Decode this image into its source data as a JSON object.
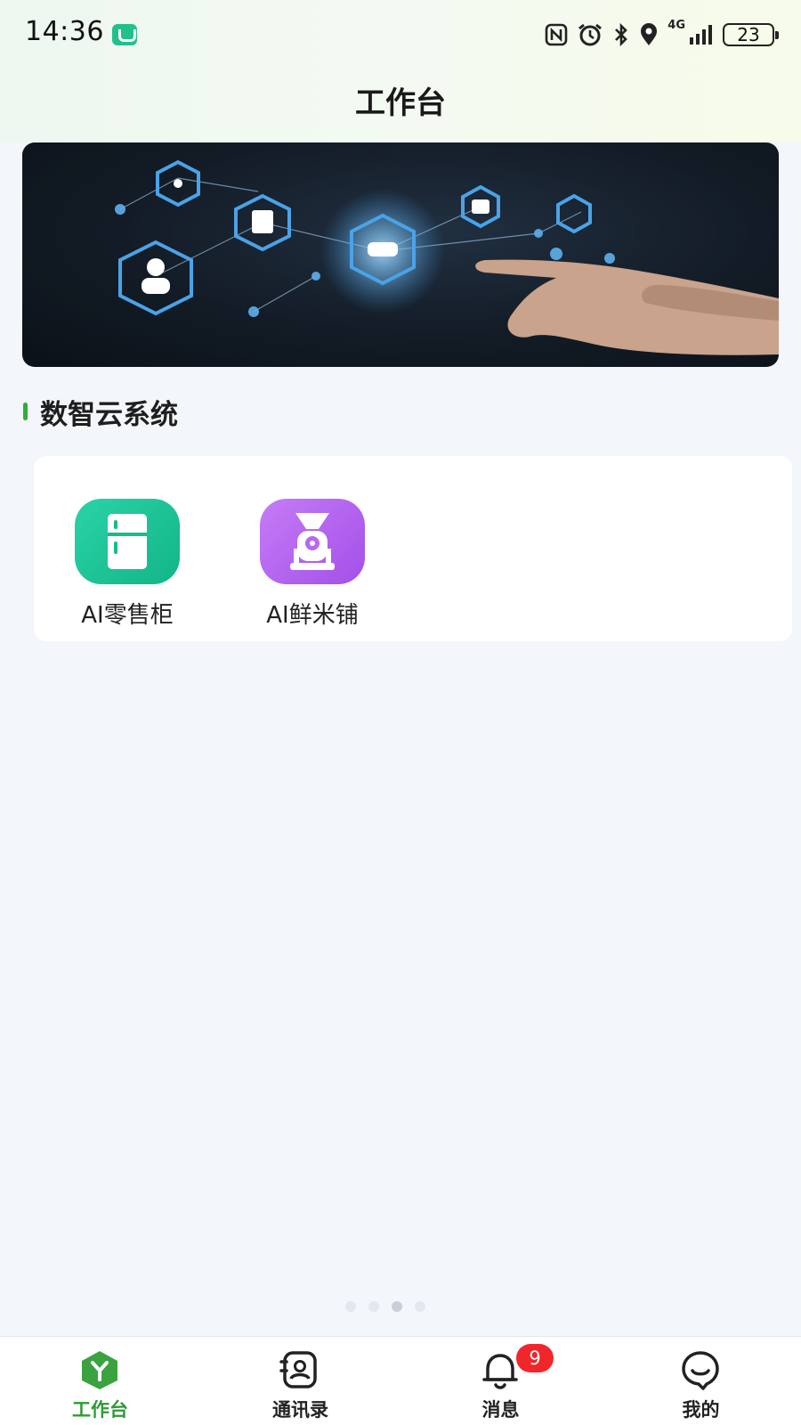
{
  "status_bar": {
    "time": "14:36",
    "network": "4G",
    "battery": "23",
    "icons": [
      "nfc-icon",
      "alarm-icon",
      "bluetooth-icon",
      "location-icon",
      "signal-icon",
      "battery-icon"
    ]
  },
  "header": {
    "title": "工作台"
  },
  "banner": {
    "icon": "tech-network-banner"
  },
  "section": {
    "title": "数智云系统"
  },
  "apps": [
    {
      "label": "AI零售柜",
      "icon": "fridge-icon",
      "color": "#1fc79a"
    },
    {
      "label": "AI鲜米铺",
      "icon": "rice-machine-icon",
      "color": "#b564f0"
    }
  ],
  "pager": {
    "count": 4,
    "active_index": 2
  },
  "tabbar": {
    "tabs": [
      {
        "label": "工作台",
        "icon": "workbench-icon",
        "active": true
      },
      {
        "label": "通讯录",
        "icon": "contacts-icon",
        "active": false
      },
      {
        "label": "消息",
        "icon": "bell-icon",
        "active": false,
        "badge": "9"
      },
      {
        "label": "我的",
        "icon": "profile-icon",
        "active": false
      }
    ]
  },
  "colors": {
    "accent": "#2e9b36",
    "badge": "#f0262a",
    "background": "#f3f6fa"
  }
}
